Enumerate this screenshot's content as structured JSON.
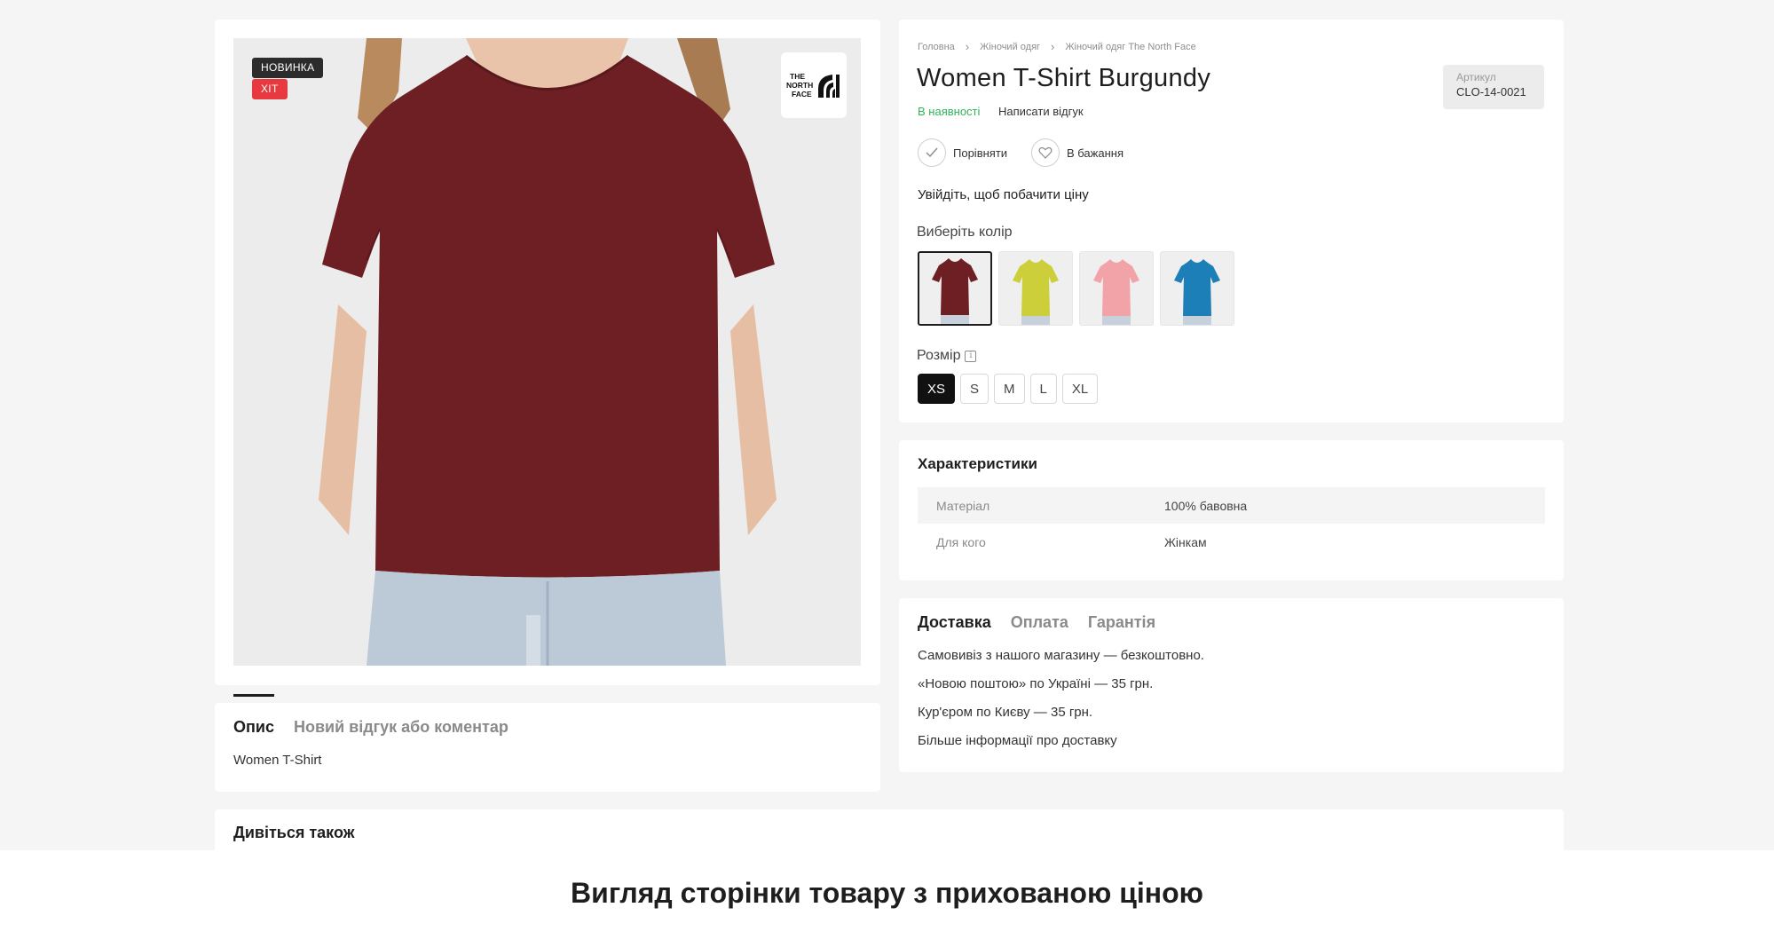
{
  "badges": {
    "new": "НОВИНКА",
    "hit": "ХІТ"
  },
  "brand": {
    "logo_text": [
      "THE",
      "NORTH",
      "FACE"
    ]
  },
  "breadcrumb": [
    "Головна",
    "Жіночий одяг",
    "Жіночий одяг The North Face"
  ],
  "product": {
    "title": "Women T-Shirt Burgundy",
    "sku_label": "Артикул",
    "sku_value": "CLO-14-0021",
    "stock": "В наявності",
    "review_link": "Написати відгук",
    "compare_label": "Порівняти",
    "wishlist_label": "В бажання",
    "login_price": "Увійдіть, щоб побачити ціну",
    "color_label": "Виберіть колір",
    "colors": [
      "#6e1f24",
      "#cccf3a",
      "#f2a3a8",
      "#1d7fb8"
    ],
    "size_label": "Розмір",
    "sizes": [
      "XS",
      "S",
      "M",
      "L",
      "XL"
    ],
    "selected_size": "XS"
  },
  "characteristics": {
    "title": "Характеристики",
    "rows": [
      {
        "key": "Матеріал",
        "value": "100% бавовна"
      },
      {
        "key": "Для кого",
        "value": "Жінкам"
      }
    ]
  },
  "delivery": {
    "tabs": [
      "Доставка",
      "Оплата",
      "Гарантія"
    ],
    "lines": [
      "Самовивіз з нашого магазину — безкоштовно.",
      "«Новою поштою» по Україні — 35 грн.",
      "Кур'єром по Києву — 35 грн.",
      "Більше інформації про доставку"
    ]
  },
  "description": {
    "tabs": [
      "Опис",
      "Новий відгук або коментар"
    ],
    "text": "Women T-Shirt"
  },
  "see_also": {
    "title": "Дивіться також"
  },
  "caption": "Вигляд сторінки товару з прихованою ціною",
  "colors": {
    "accent_green": "#2fb35a",
    "badge_dark": "#2c2c2c",
    "badge_red": "#e7393f",
    "shirt": "#6e1f24"
  }
}
